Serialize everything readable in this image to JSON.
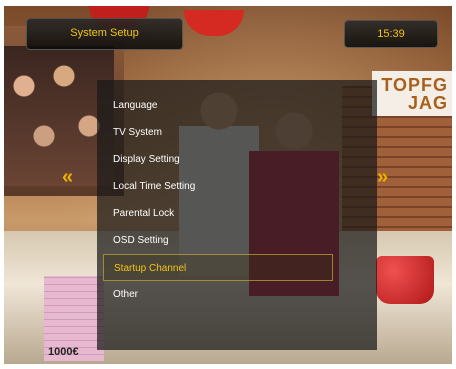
{
  "header": {
    "title": "System Setup",
    "clock": "15:39"
  },
  "menu": {
    "items": [
      {
        "label": "Language"
      },
      {
        "label": "TV System"
      },
      {
        "label": "Display Setting"
      },
      {
        "label": "Local Time Setting"
      },
      {
        "label": "Parental Lock"
      },
      {
        "label": "OSD Setting"
      },
      {
        "label": "Startup Channel"
      },
      {
        "label": "Other"
      }
    ],
    "selected_index": 6
  },
  "background": {
    "show_logo": "TOPFG\nJAG",
    "money_label": "1000€"
  },
  "colors": {
    "highlight": "#f2c419",
    "menu_text": "#ffffff"
  },
  "icons": {
    "left": "double-chevron-left-icon",
    "right": "double-chevron-right-icon"
  }
}
